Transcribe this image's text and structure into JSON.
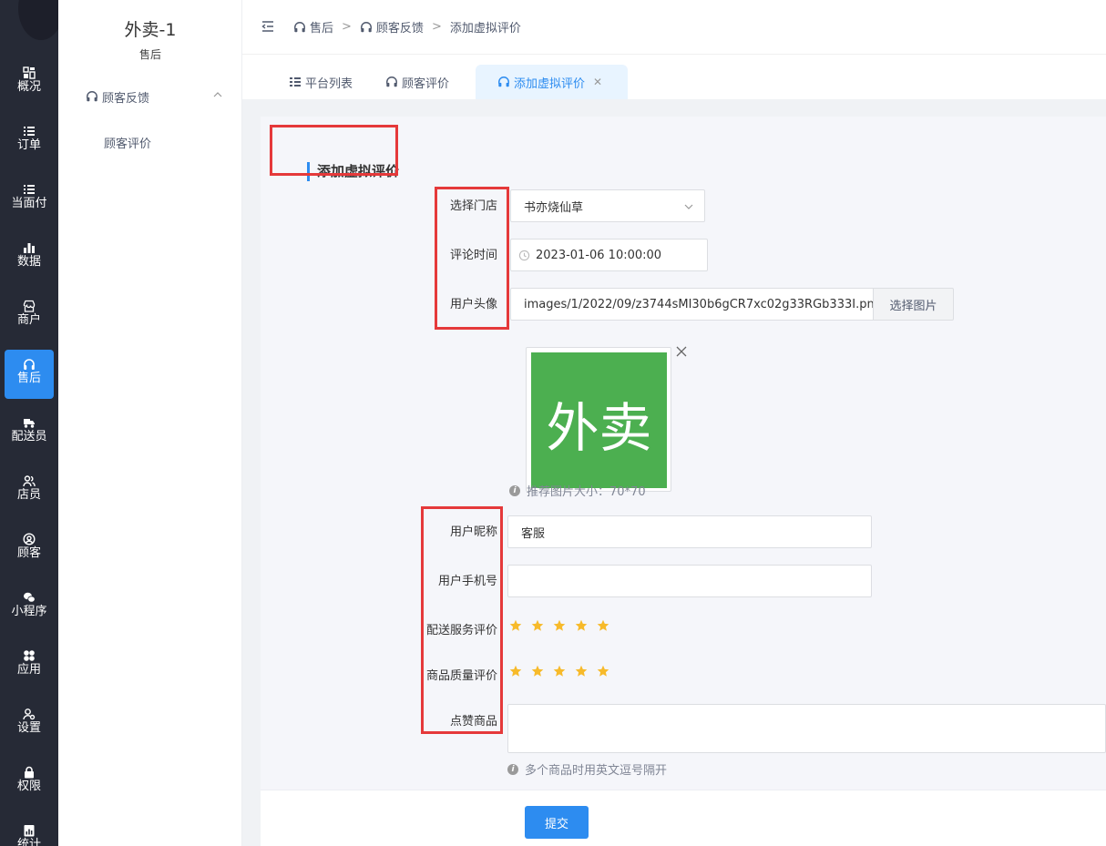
{
  "nav": {
    "items": [
      {
        "label": "概况",
        "icon": "dashboard-icon"
      },
      {
        "label": "订单",
        "icon": "list-icon"
      },
      {
        "label": "当面付",
        "icon": "list-icon"
      },
      {
        "label": "数据",
        "icon": "bar-chart-icon"
      },
      {
        "label": "商户",
        "icon": "store-icon"
      },
      {
        "label": "售后",
        "icon": "headset-icon"
      },
      {
        "label": "配送员",
        "icon": "delivery-icon"
      },
      {
        "label": "店员",
        "icon": "users-icon"
      },
      {
        "label": "顾客",
        "icon": "user-circle-icon"
      },
      {
        "label": "小程序",
        "icon": "wechat-icon"
      },
      {
        "label": "应用",
        "icon": "apps-icon"
      },
      {
        "label": "设置",
        "icon": "user-settings-icon"
      },
      {
        "label": "权限",
        "icon": "lock-icon"
      },
      {
        "label": "统计",
        "icon": "report-icon"
      }
    ],
    "active_index": 5
  },
  "subnav": {
    "shop_name": "外卖-1",
    "section": "售后",
    "group_label": "顾客反馈",
    "item_label": "顾客评价"
  },
  "breadcrumb": [
    "售后",
    "顾客反馈",
    "添加虚拟评价"
  ],
  "tabs": [
    {
      "label": "平台列表",
      "icon": "list-icon"
    },
    {
      "label": "顾客评价",
      "icon": "headset-icon"
    },
    {
      "label": "添加虚拟评价",
      "icon": "headset-icon",
      "active": true
    }
  ],
  "form": {
    "title": "添加虚拟评价",
    "store_label": "选择门店",
    "store_value": "书亦烧仙草",
    "time_label": "评论时间",
    "time_value": "2023-01-06 10:00:00",
    "avatar_label": "用户头像",
    "avatar_path": "images/1/2022/09/z3744sMI30b6gCR7xc02g33RGb333I.pn",
    "pick_image_label": "选择图片",
    "avatar_image_text": "外卖",
    "avatar_hint": "推荐图片大小：70*70",
    "nickname_label": "用户昵称",
    "nickname_value": "客服",
    "phone_label": "用户手机号",
    "phone_value": "",
    "delivery_rating_label": "配送服务评价",
    "delivery_rating": 5,
    "quality_rating_label": "商品质量评价",
    "quality_rating": 5,
    "liked_goods_label": "点赞商品",
    "liked_goods_value": "",
    "liked_goods_hint": "多个商品时用英文逗号隔开",
    "submit_label": "提交"
  },
  "colors": {
    "nav_bg": "#262a36",
    "accent": "#2d8cf0",
    "star": "#f7ba2a",
    "highlight": "#e5393a",
    "avatar_bg": "#4caf50"
  }
}
